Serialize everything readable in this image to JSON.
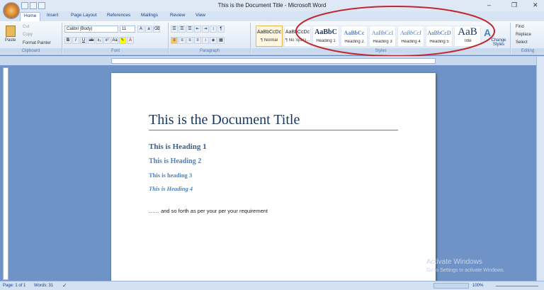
{
  "window": {
    "title": "This is the Document Title - Microsoft Word",
    "min": "–",
    "max": "❐",
    "close": "✕"
  },
  "qat_keys": [
    "1",
    "2",
    "3"
  ],
  "tabs": [
    {
      "label": "Home",
      "key": "H"
    },
    {
      "label": "Insert",
      "key": "N"
    },
    {
      "label": "Page Layout",
      "key": "P"
    },
    {
      "label": "References",
      "key": "S"
    },
    {
      "label": "Mailings",
      "key": "M"
    },
    {
      "label": "Review",
      "key": "R"
    },
    {
      "label": "View",
      "key": "W"
    }
  ],
  "clipboard": {
    "paste": "Paste",
    "cut": "Cut",
    "copy": "Copy",
    "format_painter": "Format Painter",
    "label": "Clipboard"
  },
  "font": {
    "name": "Calibri (Body)",
    "size": "11",
    "label": "Font"
  },
  "paragraph": {
    "label": "Paragraph"
  },
  "styles": {
    "label": "Styles",
    "items": [
      {
        "preview": "AaBbCcDc",
        "name": "¶ Normal"
      },
      {
        "preview": "AaBbCcDc",
        "name": "¶ No Spaci..."
      },
      {
        "preview": "AaBbC",
        "name": "Heading 1"
      },
      {
        "preview": "AaBbCc",
        "name": "Heading 2"
      },
      {
        "preview": "AaBbCcI",
        "name": "Heading 3"
      },
      {
        "preview": "AaBbCcI",
        "name": "Heading 4"
      },
      {
        "preview": "AaBbCcD",
        "name": "Heading 5"
      },
      {
        "preview": "AaB",
        "name": "Title"
      }
    ],
    "change_styles": "Change Styles"
  },
  "editing": {
    "find": "Find",
    "replace": "Replace",
    "select": "Select",
    "label": "Editing"
  },
  "document": {
    "title": "This is the Document Title",
    "h1": "This is Heading 1",
    "h2": "This is Heading 2",
    "h3": "This is heading 3",
    "h4": "This is Heading 4",
    "body": "…… and so forth as per your per your requirement"
  },
  "status": {
    "page": "Page: 1 of 1",
    "words": "Words: 31",
    "zoom": "100%"
  },
  "watermark": {
    "line1": "Activate Windows",
    "line2": "Go to Settings to activate Windows."
  },
  "annotation_color": "#c0282f"
}
